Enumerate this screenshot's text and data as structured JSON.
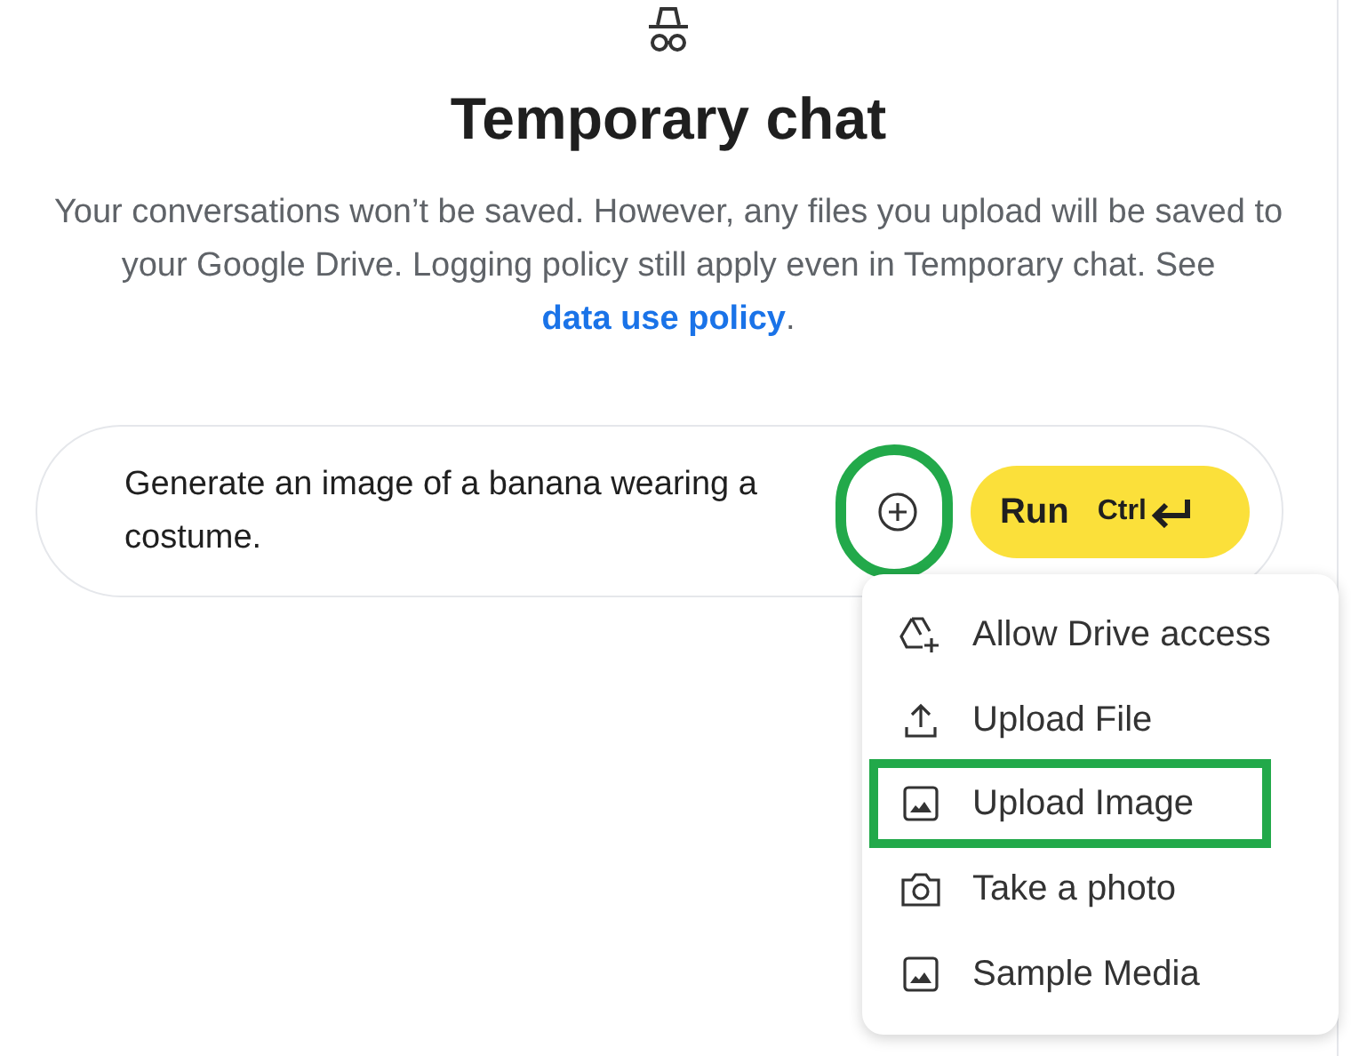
{
  "header": {
    "title": "Temporary chat",
    "notice": "Your conversations won’t be saved. However, any files you upload will be saved to your Google Drive. Logging policy still apply even in Temporary chat. See",
    "link": "data use policy",
    "notice_end": "."
  },
  "prompt": {
    "value": "Generate an image of a banana wearing a costume.",
    "add_button": {
      "highlighted": true
    },
    "run_button": {
      "label": "Run",
      "shortcut": "Ctrl"
    }
  },
  "menu": {
    "items": [
      {
        "kind": "drive",
        "label": "Allow Drive access",
        "highlighted": false
      },
      {
        "kind": "upload",
        "label": "Upload File",
        "highlighted": false
      },
      {
        "kind": "image",
        "label": "Upload Image",
        "highlighted": true
      },
      {
        "kind": "camera",
        "label": "Take a photo",
        "highlighted": false
      },
      {
        "kind": "image",
        "label": "Sample Media",
        "highlighted": false
      }
    ]
  }
}
